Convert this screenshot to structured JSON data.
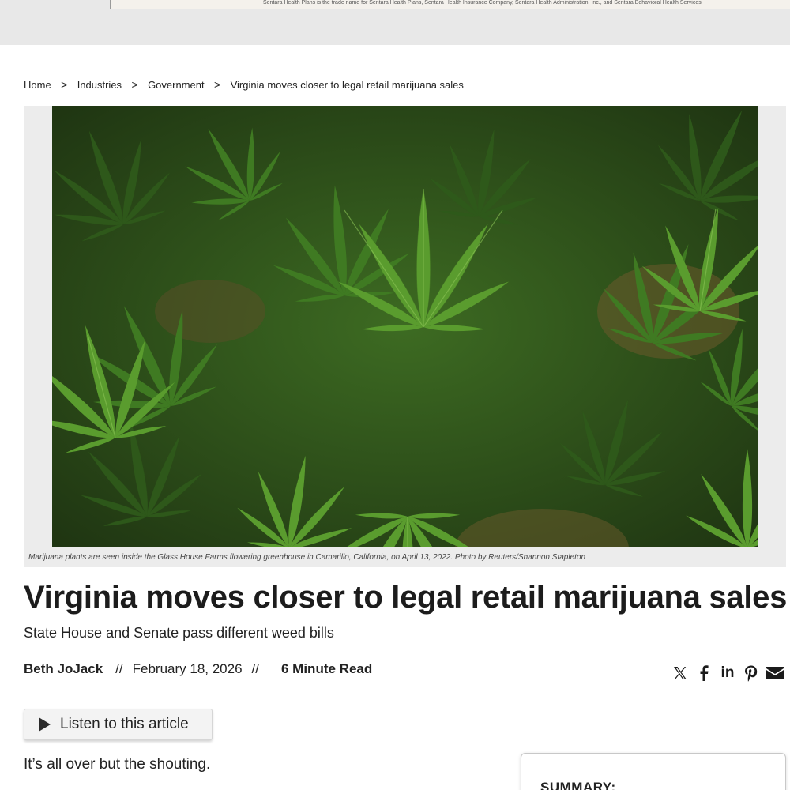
{
  "ad": {
    "disclaimer": "Sentara Health Plans is the trade name for Sentara Health Plans, Sentara Health Insurance Company, Sentara Health Administration, Inc., and Sentara Behavioral Health Services"
  },
  "breadcrumb": {
    "items": [
      "Home",
      "Industries",
      "Government",
      "Virginia moves closer to legal retail marijuana sales"
    ],
    "separator": ">"
  },
  "figure": {
    "caption": "Marijuana plants are seen inside the Glass House Farms flowering greenhouse in Camarillo, California, on April 13, 2022. Photo by Reuters/Shannon Stapleton"
  },
  "article": {
    "title": "Virginia moves closer to legal retail marijuana sales",
    "subtitle": "State House and Senate pass different weed bills",
    "author": "Beth JoJack",
    "separator": "//",
    "date": "February 18, 2026",
    "read_time": "6 Minute Read",
    "first_paragraph": "It’s all over but the shouting."
  },
  "share": {
    "icons": [
      "x-icon",
      "facebook-icon",
      "linkedin-icon",
      "pinterest-icon",
      "email-icon"
    ],
    "linkedin_text": "in"
  },
  "listen": {
    "label": "Listen to this article"
  },
  "summary": {
    "title": "SUMMARY:"
  },
  "colors": {
    "ad_band": "#e8e8e8",
    "figure_bg": "#ececec",
    "leaf_green": "#4f8f2a",
    "text": "#1f1f1f"
  }
}
